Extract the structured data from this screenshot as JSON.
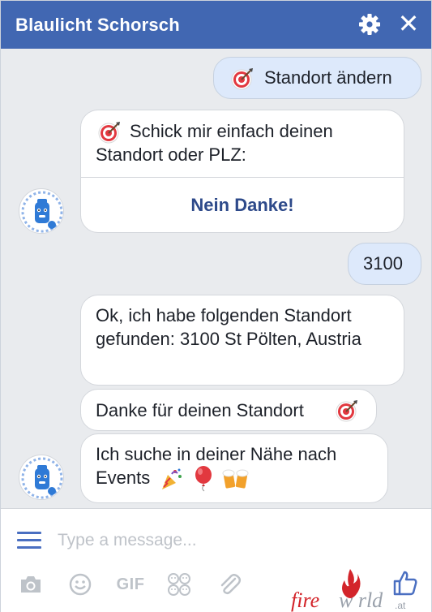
{
  "header": {
    "title": "Blaulicht Schorsch",
    "settings_icon": "gear-icon",
    "close_icon": "close-icon",
    "close_glyph": "✕",
    "color": "#4167b2"
  },
  "messages": {
    "change_location": "Standort ändern",
    "ask_location": "Schick mir einfach deinen Standort oder PLZ:",
    "no_thanks": "Nein Danke!",
    "postcode": "3100",
    "found_location": "Ok, ich habe folgenden Standort gefunden: 3100 St Pölten, Austria",
    "thanks_location": "Danke für deinen Standort",
    "searching_events": "Ich suche in deiner Nähe nach Events"
  },
  "composer": {
    "placeholder": "Type a message...",
    "gif_label": "GIF",
    "tools": [
      "menu-icon",
      "camera-icon",
      "smiley-icon",
      "gif-icon",
      "stickers-icon",
      "attachment-icon",
      "like-icon"
    ]
  },
  "brand": {
    "fire": "fire",
    "world": "w  rld",
    "tld": ".at"
  },
  "colors": {
    "outgoing_bubble": "#dde9fb",
    "incoming_bubble": "#ffffff",
    "chat_background": "#e9ebee",
    "accent": "#4a6fc1"
  }
}
